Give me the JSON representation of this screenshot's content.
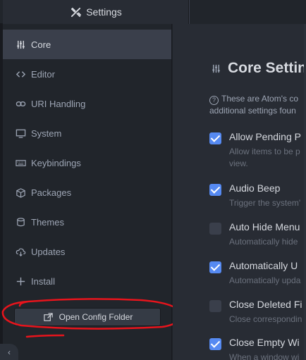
{
  "tab": {
    "title": "Settings",
    "icon": "tools-icon"
  },
  "sidebar": {
    "items": [
      {
        "label": "Core",
        "icon": "settings-sliders-icon",
        "active": true
      },
      {
        "label": "Editor",
        "icon": "code-icon",
        "active": false
      },
      {
        "label": "URI Handling",
        "icon": "link-icon",
        "active": false
      },
      {
        "label": "System",
        "icon": "device-desktop-icon",
        "active": false
      },
      {
        "label": "Keybindings",
        "icon": "keyboard-icon",
        "active": false
      },
      {
        "label": "Packages",
        "icon": "package-icon",
        "active": false
      },
      {
        "label": "Themes",
        "icon": "paintcan-icon",
        "active": false
      },
      {
        "label": "Updates",
        "icon": "cloud-download-icon",
        "active": false
      },
      {
        "label": "Install",
        "icon": "plus-icon",
        "active": false
      }
    ],
    "config_button": "Open Config Folder",
    "collapse_label": "‹"
  },
  "main": {
    "section_title": "Core Settings",
    "description_line1": "These are Atom's co",
    "description_line2": "additional settings foun",
    "settings": [
      {
        "title": "Allow Pending P",
        "desc1": "Allow items to be p",
        "desc2": "view.",
        "checked": true
      },
      {
        "title": "Audio Beep",
        "desc1": "Trigger the system'",
        "desc2": "",
        "checked": true
      },
      {
        "title": "Auto Hide Menu",
        "desc1": "Automatically hide",
        "desc2": "",
        "checked": false
      },
      {
        "title": "Automatically U",
        "desc1": "Automatically upda",
        "desc2": "",
        "checked": true
      },
      {
        "title": "Close Deleted Fi",
        "desc1": "Close correspondin",
        "desc2": "",
        "checked": false
      },
      {
        "title": "Close Empty Wi",
        "desc1": "When a window wi",
        "desc2": "",
        "checked": true
      }
    ]
  },
  "colors": {
    "accent": "#568af2",
    "annotation": "#e8141c"
  }
}
